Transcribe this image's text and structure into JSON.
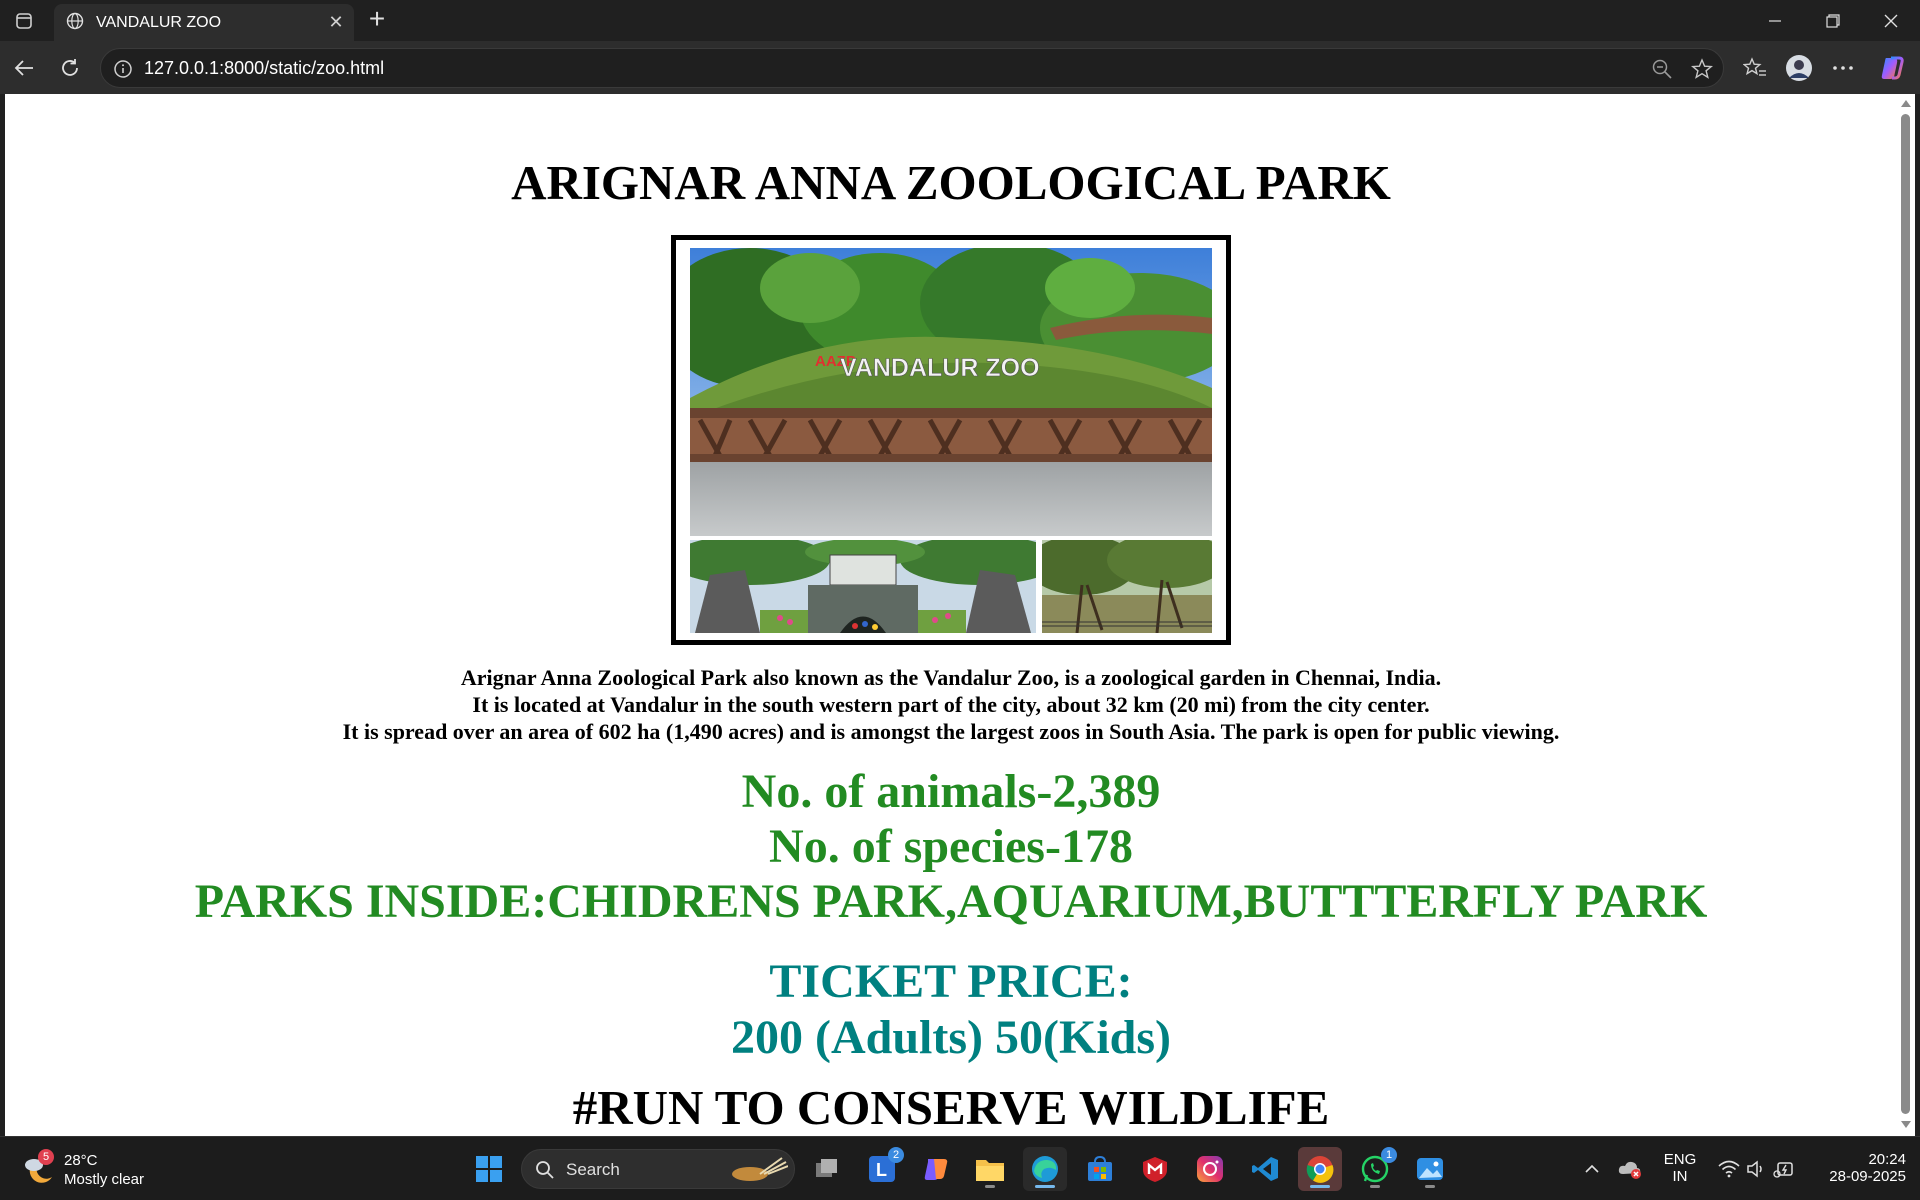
{
  "browser": {
    "tab_title": "VANDALUR ZOO",
    "url": "127.0.0.1:8000/static/zoo.html"
  },
  "page": {
    "title": "ARIGNAR ANNA ZOOLOGICAL PARK",
    "photo_sign_text": "VANDALUR ZOO",
    "photo_sign_small": "AAZP",
    "description_lines": [
      "Arignar Anna Zoological Park also known as the Vandalur Zoo, is a zoological garden in Chennai, India.",
      "It is located at Vandalur in the south western part of the city, about 32 km (20 mi) from the city center.",
      "It is spread over an area of 602 ha (1,490 acres) and is amongst the largest zoos in South Asia. The park is open for public viewing."
    ],
    "stats": {
      "animals": "No. of animals-2,389",
      "species": "No. of species-178",
      "parks": "PARKS INSIDE:CHIDRENS PARK,AQUARIUM,BUTTTERFLY PARK"
    },
    "ticket": {
      "heading": "TICKET PRICE:",
      "prices": "200 (Adults) 50(Kids)"
    },
    "slogan": "#RUN TO CONSERVE WILDLIFE",
    "colors": {
      "stats": "#228b22",
      "ticket": "#008080"
    }
  },
  "taskbar": {
    "weather_temp": "28°C",
    "weather_desc": "Mostly clear",
    "weather_badge": "5",
    "search_label": "Search",
    "teams_badge": "2",
    "whatsapp_badge": "1",
    "lang_top": "ENG",
    "lang_bottom": "IN",
    "time": "20:24",
    "date": "28-09-2025"
  }
}
